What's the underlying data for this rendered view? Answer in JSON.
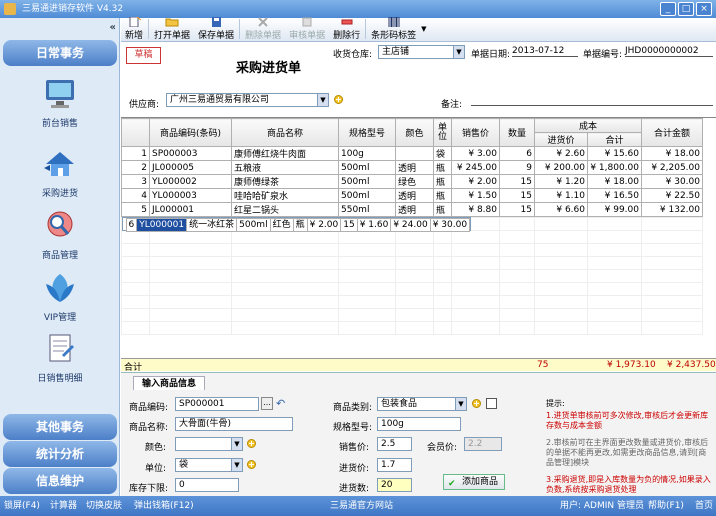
{
  "window": {
    "title": "三易通进销存软件 V4.32"
  },
  "sidebar": {
    "section_daily": "日常事务",
    "items": [
      "前台销售",
      "采购进货",
      "商品管理",
      "VIP管理",
      "日销售明细"
    ],
    "section_other": "其他事务",
    "section_stats": "统计分析",
    "section_info": "信息维护"
  },
  "toolbar": {
    "new": "新增",
    "open": "打开单据",
    "save": "保存单据",
    "delete_doc": "删除单据",
    "audit": "审核单据",
    "delete_row": "删除行",
    "barcode": "条形码标签"
  },
  "header": {
    "stamp": "草稿",
    "title": "采购进货单",
    "warehouse_label": "收货仓库:",
    "warehouse": "主店铺",
    "date_label": "单据日期:",
    "date": "2013-07-12",
    "no_label": "单据编号:",
    "no": "JHD0000000002",
    "supplier_label": "供应商:",
    "supplier": "广州三易通贸易有限公司",
    "remark_label": "备注:"
  },
  "table": {
    "headers": [
      "商品编码(条码)",
      "商品名称",
      "规格型号",
      "颜色",
      "单位",
      "销售价",
      "数量",
      "成本",
      "进货价",
      "合计",
      "合计金额"
    ],
    "rows": [
      [
        "1",
        "SP000003",
        "康师傅红烧牛肉面",
        "100g",
        "",
        "袋",
        "¥ 3.00",
        "6",
        "¥ 2.60",
        "¥ 15.60",
        "¥ 18.00"
      ],
      [
        "2",
        "JL000005",
        "五粮液",
        "500ml",
        "透明",
        "瓶",
        "¥ 245.00",
        "9",
        "¥ 200.00",
        "¥ 1,800.00",
        "¥ 2,205.00"
      ],
      [
        "3",
        "YL000002",
        "康师傅绿茶",
        "500ml",
        "绿色",
        "瓶",
        "¥ 2.00",
        "15",
        "¥ 1.20",
        "¥ 18.00",
        "¥ 30.00"
      ],
      [
        "4",
        "YL000003",
        "哇哈哈矿泉水",
        "500ml",
        "透明",
        "瓶",
        "¥ 1.50",
        "15",
        "¥ 1.10",
        "¥ 16.50",
        "¥ 22.50"
      ],
      [
        "5",
        "JL000001",
        "红星二锅头",
        "550ml",
        "透明",
        "瓶",
        "¥ 8.80",
        "15",
        "¥ 6.60",
        "¥ 99.00",
        "¥ 132.00"
      ],
      [
        "6",
        "YL000001",
        "统一冰红茶",
        "500ml",
        "红色",
        "瓶",
        "¥ 2.00",
        "15",
        "¥ 1.60",
        "¥ 24.00",
        "¥ 30.00"
      ]
    ],
    "sum_label": "合计",
    "sum_qty": "75",
    "sum_cost": "¥ 1,973.10",
    "sum_total": "¥ 2,437.50"
  },
  "entry": {
    "tab": "输入商品信息",
    "code_label": "商品编码:",
    "code": "SP000001",
    "name_label": "商品名称:",
    "name": "大骨面(牛骨)",
    "color_label": "颜色:",
    "unit_label": "单位:",
    "unit": "袋",
    "stock_label": "库存下限:",
    "stock": "0",
    "category_label": "商品类别:",
    "category": "包装食品",
    "spec_label": "规格型号:",
    "spec": "100g",
    "price_label": "销售价:",
    "price": "2.5",
    "member_label": "会员价:",
    "member": "2.2",
    "cost_label": "进货价:",
    "cost": "1.7",
    "qty_label": "进货数:",
    "qty": "20",
    "add_button": "添加商品"
  },
  "tips": {
    "title": "提示:",
    "t1": "1.进货单审核前可多次修改,审核后才会更新库存数与成本金额",
    "t2": "2.审核前可在主界面更改数量或进货价,审核后的单据不能再更改,如需更改商品信息,请到[商品管理]模块",
    "t3": "3.采购退货,即是入库数量为负的情况,如果录入负数,系统按采购退货处理"
  },
  "status": {
    "lock": "锁屏(F4)",
    "calc": "计算器",
    "skin": "切换皮肤",
    "drawer": "弹出钱箱(F12)",
    "site": "三易通官方网站",
    "user": "用户: ADMIN 管理员",
    "help": "帮助(F1)",
    "home": "首页"
  }
}
